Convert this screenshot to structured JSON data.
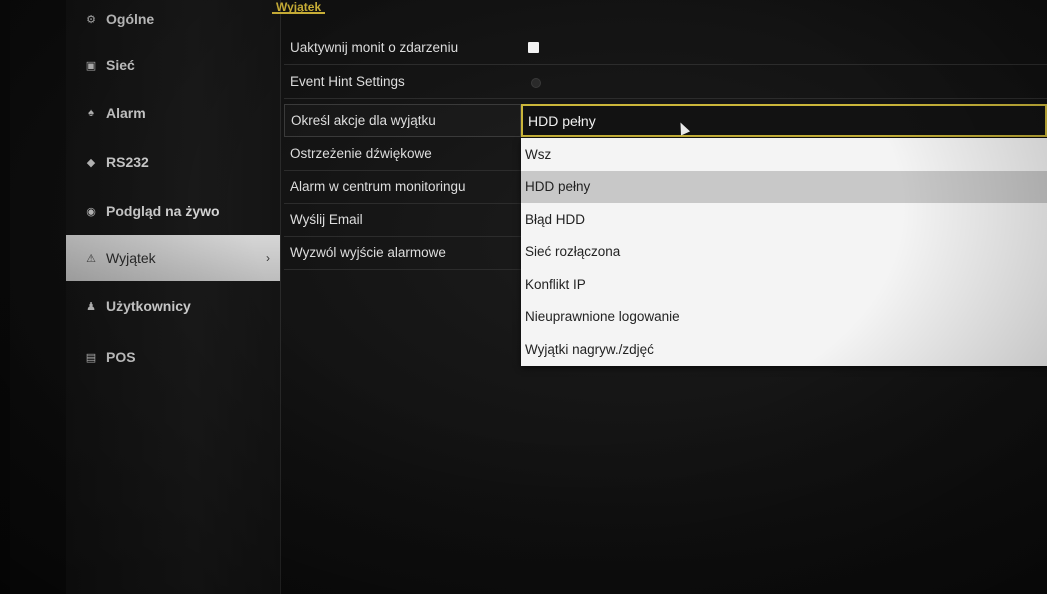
{
  "tab_header": "Wyjątek",
  "sidebar": {
    "items": [
      {
        "label": "Ogólne",
        "icon": "gear-icon",
        "glyph": "⚙"
      },
      {
        "label": "Sieć",
        "icon": "network-icon",
        "glyph": "▣"
      },
      {
        "label": "Alarm",
        "icon": "alarm-icon",
        "glyph": "♠"
      },
      {
        "label": "RS232",
        "icon": "serial-icon",
        "glyph": "◆"
      },
      {
        "label": "Podgląd na żywo",
        "icon": "eye-icon",
        "glyph": "◉"
      },
      {
        "label": "Wyjątek",
        "icon": "warning-icon",
        "glyph": "⚠",
        "active": true,
        "chevron": "›"
      },
      {
        "label": "Użytkownicy",
        "icon": "users-icon",
        "glyph": "♟"
      },
      {
        "label": "POS",
        "icon": "pos-icon",
        "glyph": "▤"
      }
    ]
  },
  "settings": {
    "rows": [
      "Uaktywnij monit o zdarzeniu",
      "Event Hint Settings",
      "Określ akcje dla wyjątku",
      "Ostrzeżenie dźwiękowe",
      "Alarm w centrum monitoringu",
      "Wyślij Email",
      "Wyzwól wyjście alarmowe"
    ]
  },
  "exception_select": {
    "value": "HDD pełny",
    "options": [
      "Wsz",
      "HDD pełny",
      "Błąd HDD",
      "Sieć rozłączona",
      "Konflikt IP",
      "Nieuprawnione logowanie",
      "Wyjątki nagryw./zdjęć"
    ],
    "selected_index": 1
  },
  "colors": {
    "accent": "#d4b83a",
    "dropdown_bg": "#f4f4f4",
    "selected_option_bg": "#c8c8c8"
  }
}
